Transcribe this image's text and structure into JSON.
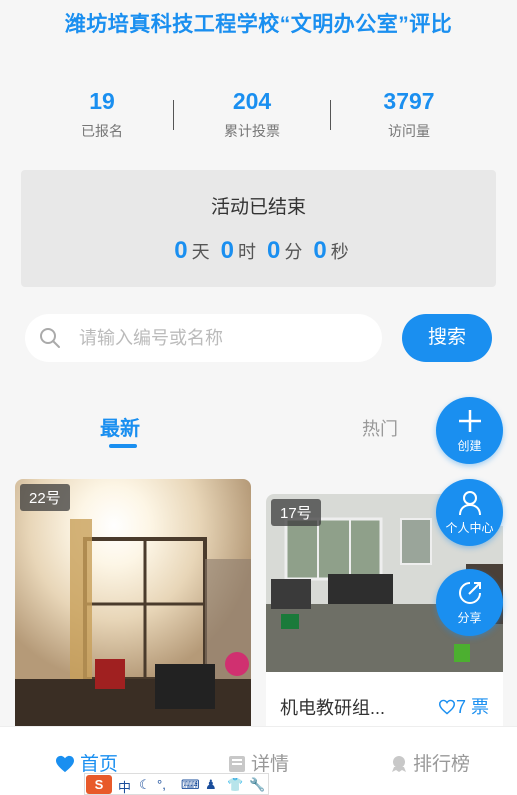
{
  "page_title": "潍坊培真科技工程学校“文明办公室”评比",
  "stats": [
    {
      "value": "19",
      "label": "已报名"
    },
    {
      "value": "204",
      "label": "累计投票"
    },
    {
      "value": "3797",
      "label": "访问量"
    }
  ],
  "countdown": {
    "status": "活动已结束",
    "days": "0",
    "days_unit": "天",
    "hours": "0",
    "hours_unit": "时",
    "minutes": "0",
    "minutes_unit": "分",
    "seconds": "0",
    "seconds_unit": "秒"
  },
  "search": {
    "placeholder": "请输入编号或名称",
    "button": "搜索"
  },
  "tabs": {
    "latest": "最新",
    "hot": "热门"
  },
  "entries": [
    {
      "number": "22号"
    },
    {
      "number": "17号",
      "name": "机电教研组...",
      "votes": "7 票"
    }
  ],
  "fabs": {
    "create": "创建",
    "profile": "个人中心",
    "share": "分享"
  },
  "bottom_nav": {
    "home": "首页",
    "detail": "详情",
    "rank": "排行榜"
  },
  "ime_bar": {
    "logo": "S",
    "mode": "中"
  },
  "colors": {
    "accent": "#1a8ff0",
    "background": "#f6f6f6"
  }
}
